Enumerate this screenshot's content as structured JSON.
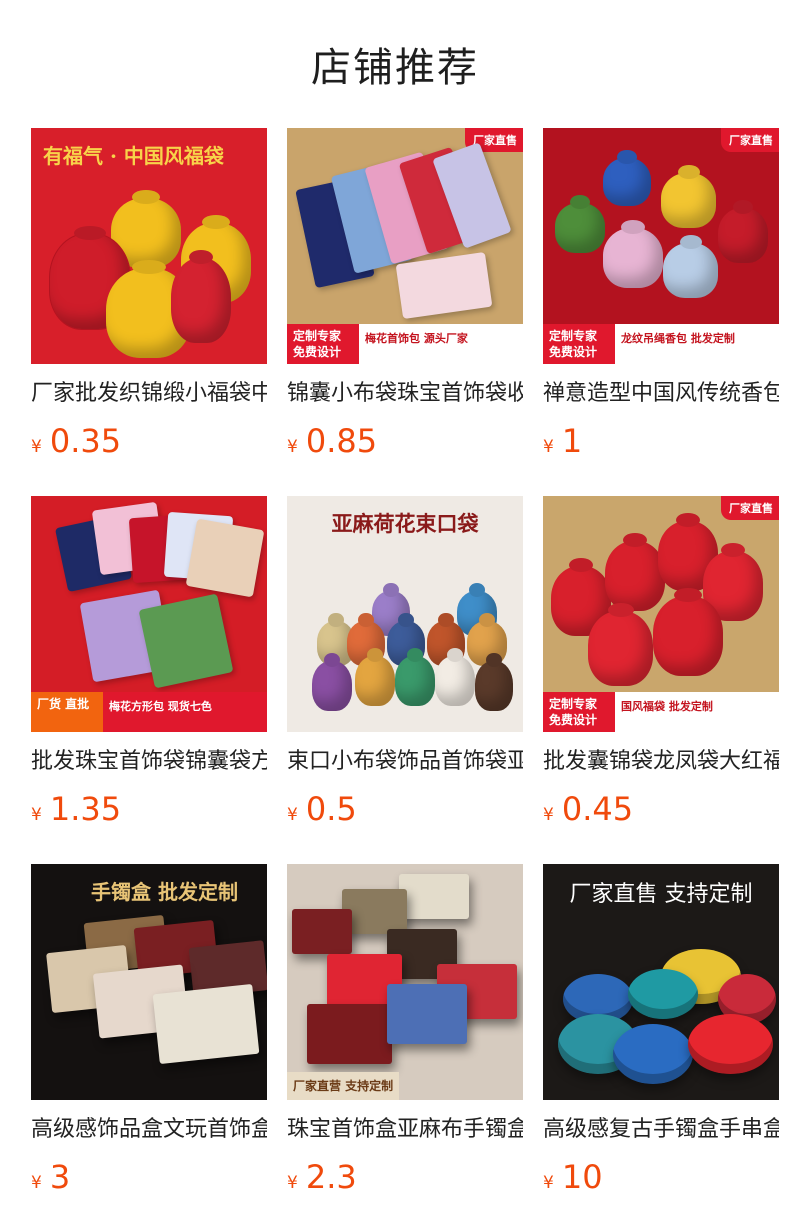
{
  "header": {
    "title": "店铺推荐"
  },
  "currency_symbol": "¥",
  "products": [
    {
      "title": "厂家批发织锦缎小福袋中国风礼品袋",
      "price": "0.35",
      "banner_top": "有福气 · 中国风福袋",
      "corner_tag": "",
      "banner_left": "",
      "banner_right": ""
    },
    {
      "title": "锦囊小布袋珠宝首饰袋收纳袋",
      "price": "0.85",
      "banner_top": "",
      "corner_tag": "厂家直售",
      "banner_left": "定制专家 免费设计",
      "banner_right": "梅花首饰包 源头厂家"
    },
    {
      "title": "禅意造型中国风传统香包",
      "price": "1",
      "banner_top": "",
      "corner_tag": "厂家直售",
      "banner_left": "定制专家 免费设计",
      "banner_right": "龙纹吊绳香包 批发定制"
    },
    {
      "title": "批发珠宝首饰袋锦囊袋方形包",
      "price": "1.35",
      "banner_top": "",
      "corner_tag": "",
      "banner_left": "厂货 直批",
      "banner_right": "梅花方形包 现货七色"
    },
    {
      "title": "束口小布袋饰品首饰袋亚麻",
      "price": "0.5",
      "banner_top": "亚麻荷花束口袋",
      "corner_tag": "",
      "banner_left": "",
      "banner_right": ""
    },
    {
      "title": "批发囊锦袋龙凤袋大红福袋",
      "price": "0.45",
      "banner_top": "",
      "corner_tag": "厂家直售",
      "banner_left": "定制专家 免费设计",
      "banner_right": "国风福袋 批发定制"
    },
    {
      "title": "高级感饰品盒文玩首饰盒",
      "price": "3",
      "banner_top": "手镯盒 批发定制",
      "corner_tag": "",
      "banner_left": "",
      "banner_right": ""
    },
    {
      "title": "珠宝首饰盒亚麻布手镯盒",
      "price": "2.3",
      "banner_top": "",
      "corner_tag": "",
      "banner_left": "厂家直营 支持定制",
      "banner_right": ""
    },
    {
      "title": "高级感复古手镯盒手串盒",
      "price": "10",
      "banner_top": "厂家直售 支持定制",
      "corner_tag": "",
      "banner_left": "",
      "banner_right": ""
    }
  ],
  "colors": {
    "price": "#f04a0c",
    "brand_red": "#e0182d"
  }
}
